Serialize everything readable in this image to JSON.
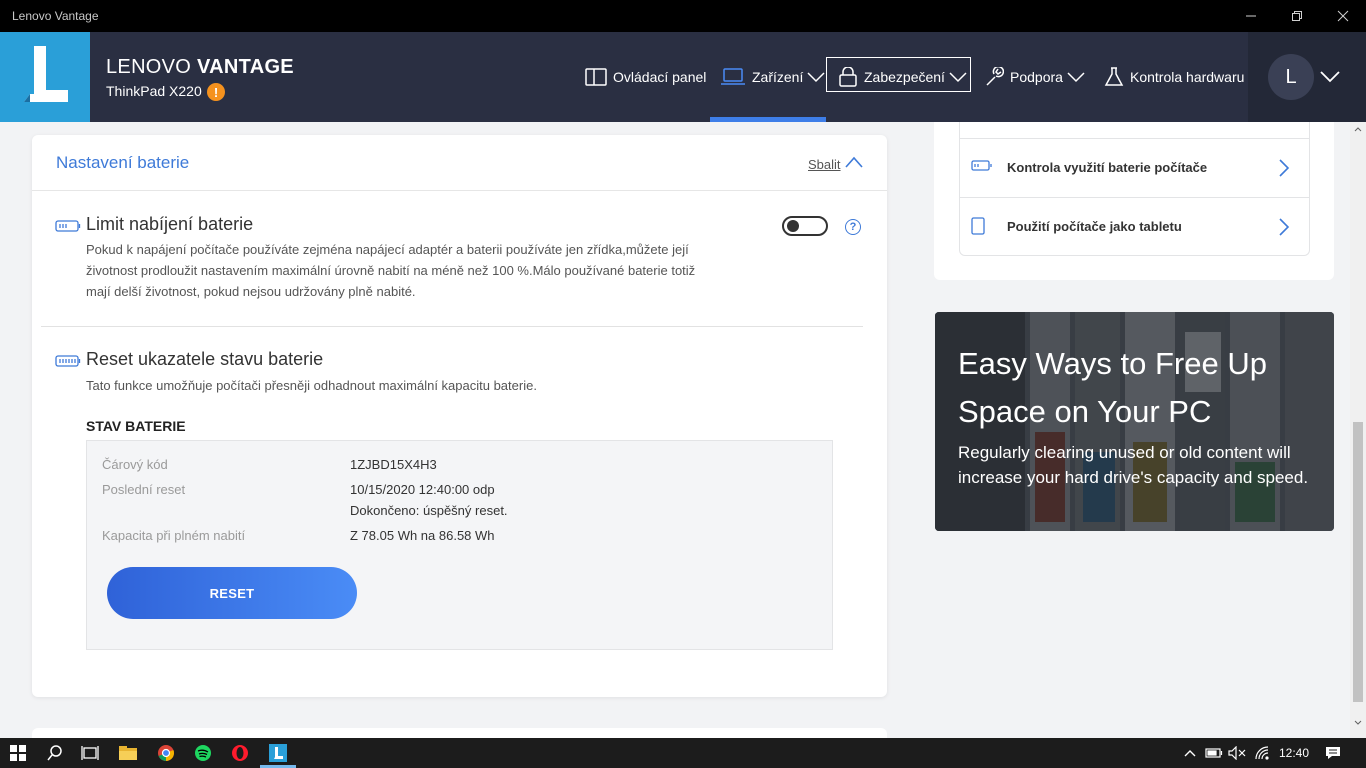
{
  "window": {
    "title": "Lenovo Vantage"
  },
  "header": {
    "brand_light": "LENOVO ",
    "brand_bold": "VANTAGE",
    "device": "ThinkPad X220",
    "warn": "!",
    "nav": [
      {
        "label": "Ovládací panel"
      },
      {
        "label": "Zařízení"
      },
      {
        "label": "Zabezpečení"
      },
      {
        "label": "Podpora"
      },
      {
        "label": "Kontrola hardwaru"
      }
    ],
    "avatar_letter": "L",
    "accent": "#3e7ee8"
  },
  "battery_card": {
    "title": "Nastavení baterie",
    "collapse_label": "Sbalit",
    "charge_limit": {
      "title": "Limit nabíjení baterie",
      "desc1": "Pokud k napájení počítače používáte zejména napájecí adaptér a baterii používáte jen zřídka,můžete její",
      "desc2": "životnost prodloužit nastavením maximální úrovně nabití na méně než 100 %.Málo používané baterie totiž",
      "desc3": "mají delší životnost, pokud nejsou udržovány plně nabité.",
      "toggle_on": false,
      "help": "?"
    },
    "gauge_reset": {
      "title": "Reset ukazatele stavu baterie",
      "desc": "Tato funkce umožňuje počítači přesněji odhadnout maximální kapacitu baterie."
    },
    "status": {
      "title": "STAV BATERIE",
      "barcode_label": "Čárový kód",
      "barcode_value": "1ZJBD15X4H3",
      "last_reset_label": "Poslední reset",
      "last_reset_value": "10/15/2020 12:40:00 odp",
      "last_reset_result": "Dokončeno: úspěšný reset.",
      "capacity_label": "Kapacita při plném nabití",
      "capacity_value": "Z 78.05 Wh na 86.58 Wh",
      "reset_button": "RESET"
    }
  },
  "right_panel": {
    "links": [
      {
        "label": "Kontrola využití baterie počítače"
      },
      {
        "label": "Použití počítače jako tabletu"
      }
    ],
    "banner": {
      "title": "Easy Ways to Free Up Space on Your PC",
      "text": "Regularly clearing unused or old content will increase your hard drive's capacity and speed."
    }
  },
  "taskbar": {
    "clock": "12:40"
  }
}
